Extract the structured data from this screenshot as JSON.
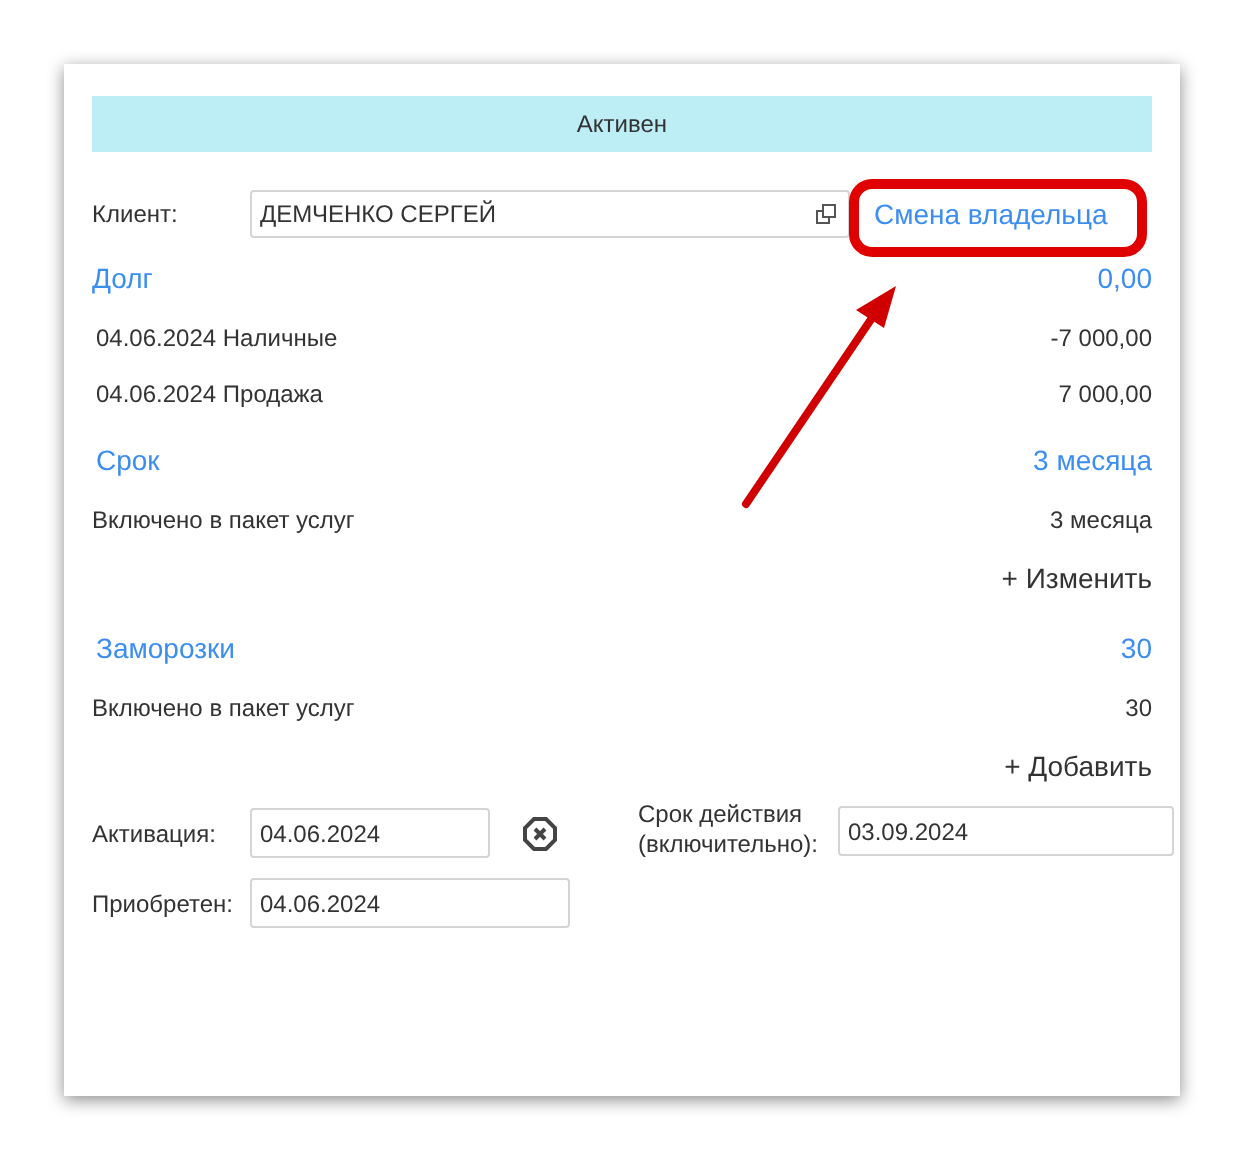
{
  "status": "Активен",
  "client": {
    "label": "Клиент:",
    "value": "ДЕМЧЕНКО СЕРГЕЙ",
    "link": "Смена владельца"
  },
  "sections": [
    {
      "title": "Долг",
      "total": "0,00",
      "rows": [
        {
          "label": "04.06.2024 Наличные",
          "value": "-7 000,00"
        },
        {
          "label": "04.06.2024 Продажа",
          "value": "7 000,00"
        }
      ]
    },
    {
      "title": "Срок",
      "total": "3 месяца",
      "rows": [
        {
          "label": "Включено в пакет услуг",
          "value": "3 месяца"
        }
      ],
      "action": "+ Изменить"
    },
    {
      "title": "Заморозки",
      "total": "30",
      "rows": [
        {
          "label": "Включено в пакет услуг",
          "value": "30"
        }
      ],
      "action": "+ Добавить"
    }
  ],
  "activation": {
    "label": "Активация:",
    "value": "04.06.2024"
  },
  "valid_until": {
    "label": "Срок действия (включительно):",
    "value": "03.09.2024"
  },
  "purchased": {
    "label": "Приобретен:",
    "value": "04.06.2024"
  }
}
